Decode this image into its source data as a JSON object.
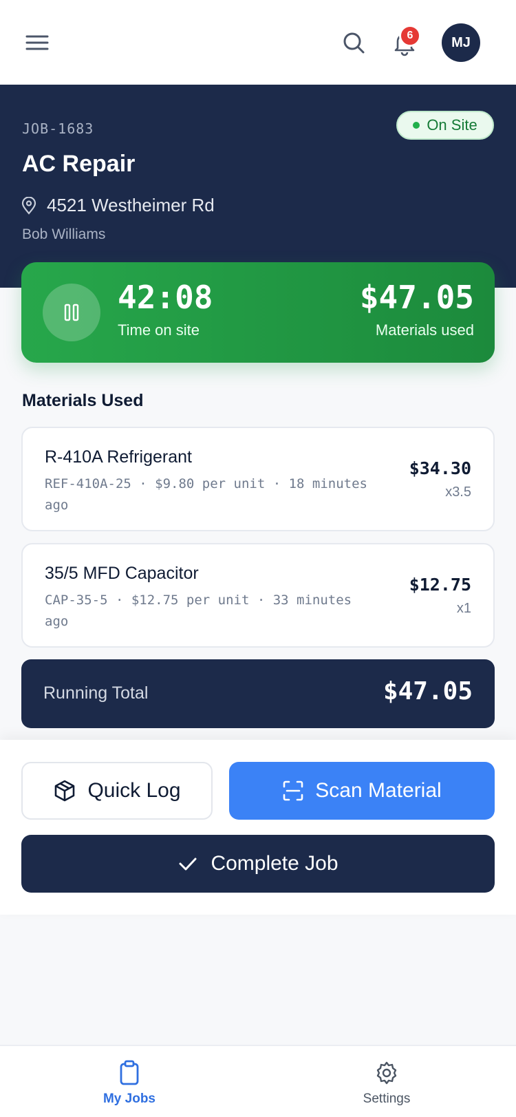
{
  "header": {
    "notification_count": "6",
    "avatar_initials": "MJ",
    "icons": [
      "menu-icon",
      "search-icon",
      "bell-icon"
    ]
  },
  "job": {
    "id": "JOB-1683",
    "status": "On Site",
    "title": "AC Repair",
    "address": "4521 Westheimer Rd",
    "client": "Bob Williams"
  },
  "timer": {
    "time_value": "42:08",
    "time_label": "Time on site",
    "materials_value": "$47.05",
    "materials_label": "Materials used"
  },
  "materials": {
    "section_title": "Materials Used",
    "items": [
      {
        "name": "R-410A Refrigerant",
        "meta": "REF-410A-25 · $9.80 per unit · 18 minutes ago",
        "price": "$34.30",
        "qty": "x3.5"
      },
      {
        "name": "35/5 MFD Capacitor",
        "meta": "CAP-35-5 · $12.75 per unit · 33 minutes ago",
        "price": "$12.75",
        "qty": "x1"
      }
    ],
    "running_total_label": "Running Total",
    "running_total_value": "$47.05"
  },
  "actions": {
    "quick_log": "Quick Log",
    "scan_material": "Scan Material",
    "complete_job": "Complete Job"
  },
  "nav": {
    "jobs": "My Jobs",
    "settings": "Settings"
  },
  "colors": {
    "navy": "#1c2a4a",
    "green": "#27a74b",
    "blue": "#3b82f6",
    "badge_red": "#e53935"
  }
}
